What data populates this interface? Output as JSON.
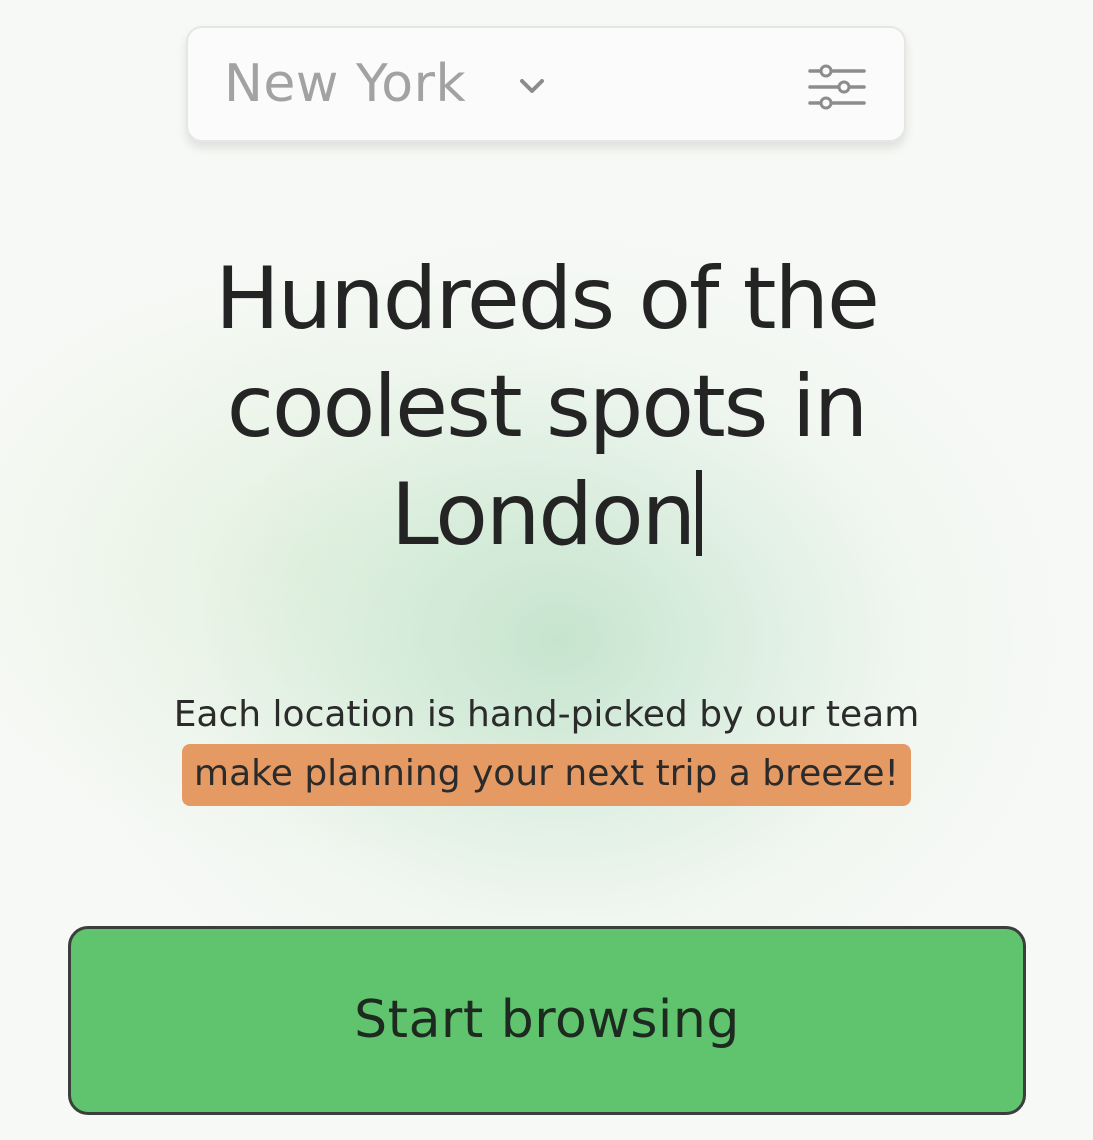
{
  "city_selector": {
    "selected_city": "New York",
    "chevron_icon": "chevron-down-icon",
    "filter_icon": "sliders-icon"
  },
  "hero": {
    "headline_line1": "Hundreds of the",
    "headline_line2": "coolest spots in",
    "headline_line3": "London",
    "subtext_line1": "Each location is hand-picked by our team",
    "subtext_highlight": "make planning your next trip a breeze!"
  },
  "cta": {
    "start_label": "Start browsing"
  },
  "colors": {
    "highlight": "#e59a64",
    "button_green": "#5fc46d",
    "text_dark": "#242424",
    "placeholder_gray": "#a2a2a2"
  }
}
